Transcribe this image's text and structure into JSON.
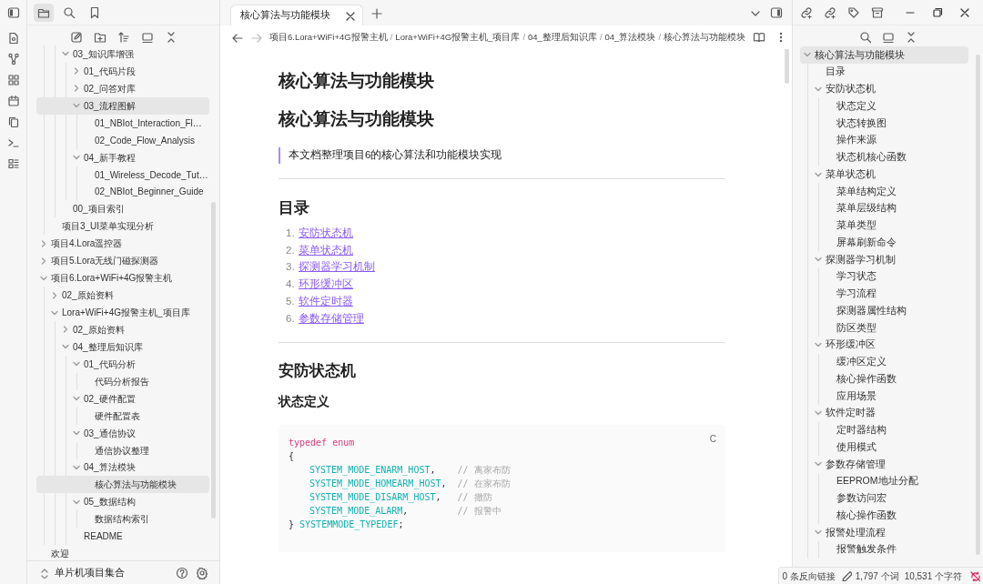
{
  "sidebar_tabs": [
    {
      "kind": "files",
      "selected": true
    },
    {
      "kind": "search",
      "selected": false
    },
    {
      "kind": "bookmarks",
      "selected": false
    }
  ],
  "file_tree": [
    {
      "kind": "offscreen",
      "children": [
        {
          "kind": "offscreen",
          "children": [
            {
              "kind": "folder",
              "label": "03_知识库增强",
              "expanded": true,
              "selected": false,
              "children": [
                {
                  "kind": "folder",
                  "label": "01_代码片段",
                  "expanded": false,
                  "selected": false
                },
                {
                  "kind": "folder",
                  "label": "02_问答对库",
                  "expanded": false,
                  "selected": false
                },
                {
                  "kind": "folder",
                  "label": "03_流程图解",
                  "expanded": true,
                  "selected": true,
                  "children": [
                    {
                      "kind": "file",
                      "label": "01_NBIot_Interaction_Fl…",
                      "selected": false
                    },
                    {
                      "kind": "file",
                      "label": "02_Code_Flow_Analysis",
                      "selected": false
                    }
                  ]
                },
                {
                  "kind": "folder",
                  "label": "04_新手教程",
                  "expanded": true,
                  "selected": false,
                  "children": [
                    {
                      "kind": "file",
                      "label": "01_Wireless_Decode_Tut…",
                      "selected": false
                    },
                    {
                      "kind": "file",
                      "label": "02_NBIot_Beginner_Guide",
                      "selected": false
                    }
                  ]
                }
              ]
            },
            {
              "kind": "file",
              "label": "00_项目索引",
              "selected": false
            }
          ]
        },
        {
          "kind": "file",
          "label": "项目3_UI菜单实现分析",
          "selected": false
        }
      ]
    },
    {
      "kind": "folder",
      "label": "项目4.Lora遥控器",
      "expanded": false,
      "selected": false
    },
    {
      "kind": "folder",
      "label": "项目5.Lora无线门磁探测器",
      "expanded": false,
      "selected": false
    },
    {
      "kind": "folder",
      "label": "项目6.Lora+WiFi+4G报警主机",
      "expanded": true,
      "selected": false,
      "children": [
        {
          "kind": "folder",
          "label": "02_原始资料",
          "expanded": false,
          "selected": false
        },
        {
          "kind": "folder",
          "label": "Lora+WiFi+4G报警主机_项目库",
          "expanded": true,
          "selected": false,
          "children": [
            {
              "kind": "folder",
              "label": "02_原始资料",
              "expanded": false,
              "selected": false
            },
            {
              "kind": "folder",
              "label": "04_整理后知识库",
              "expanded": true,
              "selected": false,
              "children": [
                {
                  "kind": "folder",
                  "label": "01_代码分析",
                  "expanded": true,
                  "selected": false,
                  "children": [
                    {
                      "kind": "file",
                      "label": "代码分析报告",
                      "selected": false
                    }
                  ]
                },
                {
                  "kind": "folder",
                  "label": "02_硬件配置",
                  "expanded": true,
                  "selected": false,
                  "children": [
                    {
                      "kind": "file",
                      "label": "硬件配置表",
                      "selected": false
                    }
                  ]
                },
                {
                  "kind": "folder",
                  "label": "03_通信协议",
                  "expanded": true,
                  "selected": false,
                  "children": [
                    {
                      "kind": "file",
                      "label": "通信协议整理",
                      "selected": false
                    }
                  ]
                },
                {
                  "kind": "folder",
                  "label": "04_算法模块",
                  "expanded": true,
                  "selected": false,
                  "children": [
                    {
                      "kind": "file",
                      "label": "核心算法与功能模块",
                      "selected": true
                    }
                  ]
                },
                {
                  "kind": "folder",
                  "label": "05_数据结构",
                  "expanded": true,
                  "selected": false,
                  "children": [
                    {
                      "kind": "file",
                      "label": "数据结构索引",
                      "selected": false
                    }
                  ]
                },
                {
                  "kind": "file",
                  "label": "README",
                  "selected": false
                }
              ]
            }
          ]
        }
      ]
    },
    {
      "kind": "file",
      "label": "欢迎",
      "selected": false
    }
  ],
  "vault": {
    "name": "单片机项目集合"
  },
  "tabs": [
    {
      "title": "核心算法与功能模块",
      "selected": true
    }
  ],
  "breadcrumb": {
    "separator": "/",
    "items": [
      "项目6.Lora+WiFi+4G报警主机",
      "Lora+WiFi+4G报警主机_项目库",
      "04_整理后知识库",
      "04_算法模块",
      "核心算法与功能模块"
    ]
  },
  "content": [
    {
      "kind": "title",
      "text": "核心算法与功能模块"
    },
    {
      "kind": "h1",
      "text": "核心算法与功能模块"
    },
    {
      "kind": "quote",
      "text": "本文档整理项目6的核心算法和功能模块实现"
    },
    {
      "kind": "hr"
    },
    {
      "kind": "h2",
      "text": "目录"
    },
    {
      "kind": "ol",
      "items": [
        {
          "number": "1.",
          "text": "安防状态机"
        },
        {
          "number": "2.",
          "text": "菜单状态机"
        },
        {
          "number": "3.",
          "text": "探测器学习机制"
        },
        {
          "number": "4.",
          "text": "环形缓冲区"
        },
        {
          "number": "5.",
          "text": "软件定时器"
        },
        {
          "number": "6.",
          "text": "参数存储管理"
        }
      ]
    },
    {
      "kind": "hr"
    },
    {
      "kind": "h2",
      "text": "安防状态机"
    },
    {
      "kind": "h3",
      "text": "状态定义"
    },
    {
      "kind": "code",
      "lang": "C",
      "lines": [
        [
          {
            "kind": "keyword",
            "text": "typedef enum"
          }
        ],
        [
          {
            "kind": "plain",
            "text": "{"
          }
        ],
        [
          {
            "kind": "constant",
            "indent": true,
            "text": "SYSTEM_MODE_ENARM_HOST"
          },
          {
            "kind": "plain",
            "text": ",    "
          },
          {
            "kind": "comment",
            "text": "// 离家布防"
          }
        ],
        [
          {
            "kind": "constant",
            "indent": true,
            "text": "SYSTEM_MODE_HOMEARM_HOST"
          },
          {
            "kind": "plain",
            "text": ",  "
          },
          {
            "kind": "comment",
            "text": "// 在家布防"
          }
        ],
        [
          {
            "kind": "constant",
            "indent": true,
            "text": "SYSTEM_MODE_DISARM_HOST"
          },
          {
            "kind": "plain",
            "text": ",   "
          },
          {
            "kind": "comment",
            "text": "// 撤防"
          }
        ],
        [
          {
            "kind": "constant",
            "indent": true,
            "text": "SYSTEM_MODE_ALARM"
          },
          {
            "kind": "plain",
            "text": ",         "
          },
          {
            "kind": "comment",
            "text": "// 报警中"
          }
        ],
        [
          {
            "kind": "plain",
            "text": "} "
          },
          {
            "kind": "constant",
            "text": "SYSTEMMODE_TYPEDEF"
          },
          {
            "kind": "plain",
            "text": ";"
          }
        ]
      ]
    }
  ],
  "outline": [
    {
      "label": "核心算法与功能模块",
      "expanded": true,
      "selected": true,
      "children": [
        {
          "label": "目录",
          "selected": false
        },
        {
          "label": "安防状态机",
          "expanded": true,
          "selected": false,
          "children": [
            {
              "label": "状态定义",
              "selected": false
            },
            {
              "label": "状态转换图",
              "selected": false
            },
            {
              "label": "操作来源",
              "selected": false
            },
            {
              "label": "状态机核心函数",
              "selected": false
            }
          ]
        },
        {
          "label": "菜单状态机",
          "expanded": true,
          "selected": false,
          "children": [
            {
              "label": "菜单结构定义",
              "selected": false
            },
            {
              "label": "菜单层级结构",
              "selected": false
            },
            {
              "label": "菜单类型",
              "selected": false
            },
            {
              "label": "屏幕刷新命令",
              "selected": false
            }
          ]
        },
        {
          "label": "探测器学习机制",
          "expanded": true,
          "selected": false,
          "children": [
            {
              "label": "学习状态",
              "selected": false
            },
            {
              "label": "学习流程",
              "selected": false
            },
            {
              "label": "探测器属性结构",
              "selected": false
            },
            {
              "label": "防区类型",
              "selected": false
            }
          ]
        },
        {
          "label": "环形缓冲区",
          "expanded": true,
          "selected": false,
          "children": [
            {
              "label": "缓冲区定义",
              "selected": false
            },
            {
              "label": "核心操作函数",
              "selected": false
            },
            {
              "label": "应用场景",
              "selected": false
            }
          ]
        },
        {
          "label": "软件定时器",
          "expanded": true,
          "selected": false,
          "children": [
            {
              "label": "定时器结构",
              "selected": false
            },
            {
              "label": "使用模式",
              "selected": false
            }
          ]
        },
        {
          "label": "参数存储管理",
          "expanded": true,
          "selected": false,
          "children": [
            {
              "label": "EEPROM地址分配",
              "selected": false
            },
            {
              "label": "参数访问宏",
              "selected": false
            },
            {
              "label": "核心操作函数",
              "selected": false
            }
          ]
        },
        {
          "label": "报警处理流程",
          "expanded": true,
          "selected": false,
          "children": [
            {
              "label": "报警触发条件",
              "selected": false
            }
          ]
        }
      ]
    }
  ],
  "status_bar": {
    "backlinks": "0 条反向链接",
    "words": "1,797 个词",
    "chars": "10,531 个字符"
  }
}
